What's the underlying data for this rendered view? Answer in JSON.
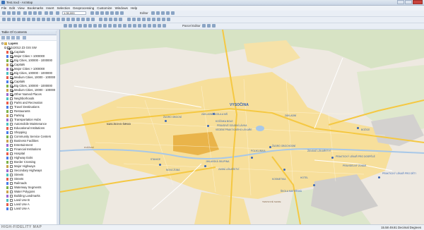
{
  "window": {
    "title": "Test.mxd - ArcMap"
  },
  "menu": [
    "File",
    "Edit",
    "View",
    "Bookmarks",
    "Insert",
    "Selection",
    "Geoprocessing",
    "Customize",
    "Windows",
    "Help"
  ],
  "toolbar": {
    "scale": "1:35,000",
    "editor_label": "Editor",
    "parcel_editor_label": "Parcel Editor"
  },
  "toc": {
    "title": "Table Of Contents",
    "root": "Layers",
    "group": "DJ2012 Z3 GIS SW",
    "layers": [
      {
        "label": "Capitals",
        "checked": true
      },
      {
        "label": "Major Cities > 1000000",
        "checked": true
      },
      {
        "label": "Big Cities, 100000 - 1000000",
        "checked": true
      },
      {
        "label": "Capitals",
        "checked": true
      },
      {
        "label": "Major Cities > 1000000",
        "checked": true
      },
      {
        "label": "Big Cities, 100000 - 1000000",
        "checked": true
      },
      {
        "label": "Medium Cities, 10000 - 100000",
        "checked": true
      },
      {
        "label": "Capitals",
        "checked": true
      },
      {
        "label": "Big Cities, 100000 - 1000000",
        "checked": true
      },
      {
        "label": "Medium Cities, 10000 - 100000",
        "checked": true
      },
      {
        "label": "Other Named Places",
        "checked": true
      },
      {
        "label": "Neighborhoods",
        "checked": false
      },
      {
        "label": "Parks and Recreation",
        "checked": false
      },
      {
        "label": "Travel Destinations",
        "checked": false
      },
      {
        "label": "Restaurants",
        "checked": false
      },
      {
        "label": "Parking",
        "checked": false
      },
      {
        "label": "Transportation Hubs",
        "checked": false
      },
      {
        "label": "Automobile Maintenance",
        "checked": false
      },
      {
        "label": "Educational Institutions",
        "checked": false
      },
      {
        "label": "Shopping",
        "checked": false
      },
      {
        "label": "Community Service Centers",
        "checked": false
      },
      {
        "label": "Business Facilities",
        "checked": false
      },
      {
        "label": "Entertainment",
        "checked": false
      },
      {
        "label": "Financial Institutions",
        "checked": false
      },
      {
        "label": "Hospital",
        "checked": false
      },
      {
        "label": "Highway Exits",
        "checked": false
      },
      {
        "label": "Border Crossing",
        "checked": false
      },
      {
        "label": "Major Highways",
        "checked": false
      },
      {
        "label": "Secondary Highways",
        "checked": false
      },
      {
        "label": "Streets",
        "checked": false
      },
      {
        "label": "Streets",
        "checked": false
      },
      {
        "label": "Railroads",
        "checked": false
      },
      {
        "label": "Waterway Segments",
        "checked": false
      },
      {
        "label": "Water Polygons",
        "checked": false
      },
      {
        "label": "Building Landmarks",
        "checked": false
      },
      {
        "label": "Land Use B",
        "checked": false
      },
      {
        "label": "Land Use A",
        "checked": false
      },
      {
        "label": "Land Use A",
        "checked": false
      }
    ]
  },
  "map": {
    "labels": {
      "city": "VYSOČINA",
      "district": "NAVLÍKOVO ŠIROD",
      "l1": "ŽUDRO OBOCNÍ",
      "l2": "ZÁKLADNÍ ŠKOLA A MŠ",
      "l3": "KOČÍNKA BOLE",
      "l4": "PRAVDIVÉ SOUDNÍ LÁVKA",
      "l5": "VEDENÍ PRAKTICKÉHO LÉKAŘE",
      "l6": "ŽUDRO OBOCHODNÍ",
      "l7": "PRAKTICKÝ LÉKAŘ PRO DOSPĚLÉ",
      "l8": "PRAVIDELNÝ ŽOBÁR",
      "l9": "POLIKLINIKA",
      "l10": "BOŽICE",
      "l11": "NOVÁ ŽOBÁ",
      "l12": "JIHLAVSKÁ SKUPINA",
      "l13": "ZUBNÍ LÉKAŘSTVÍ",
      "l14": "ŽENSKÉ LÉKAŘSTVÍ",
      "l15": "KOSMETIKA",
      "l16": "STANICE",
      "l17": "PRAKTICKÝ LÉKAŘ PRO DĚTI",
      "l18": "ŠKOLA MATEŘSKÁ",
      "l19": "TENISOVÉ SHIRE",
      "l20": "HOTEL",
      "l21": "POŽÁRNÍ",
      "l22": "ZÁKLADNÍ"
    }
  },
  "status": {
    "coords": "15.58  49.81 Decimal Degrees",
    "watermark": "HIGH-FIDELITY MAP"
  }
}
